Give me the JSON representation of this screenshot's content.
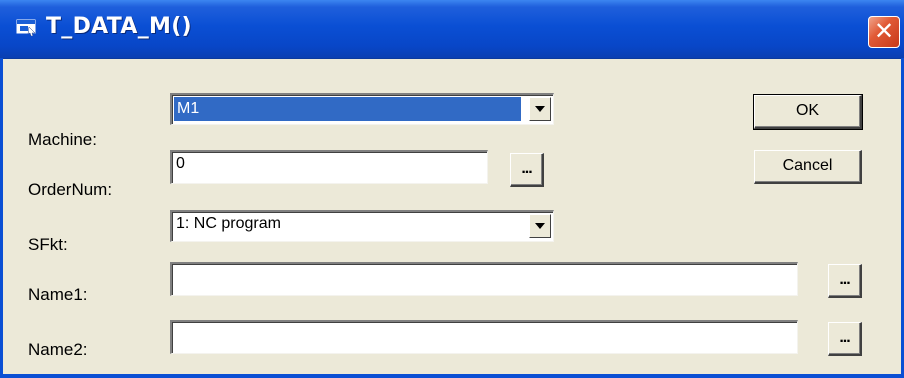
{
  "window": {
    "title": "T_DATA_M()",
    "close_label": "✕"
  },
  "fields": {
    "machine": {
      "label": "Machine:",
      "value": "M1"
    },
    "ordernum": {
      "label": "OrderNum:",
      "value": "0",
      "browse_label": "..."
    },
    "sfkt": {
      "label": "SFkt:",
      "value": "1: NC program"
    },
    "name1": {
      "label": "Name1:",
      "value": "",
      "browse_label": "..."
    },
    "name2": {
      "label": "Name2:",
      "value": "",
      "browse_label": "..."
    }
  },
  "buttons": {
    "ok": "OK",
    "cancel": "Cancel"
  },
  "colors": {
    "titlebar": "#0a4fd4",
    "dialog_bg": "#ece9d8",
    "selection": "#316ac5",
    "close": "#e15a36"
  },
  "icons": {
    "title_icon": "window-icon",
    "dropdown": "chevron-down-icon",
    "close": "close-icon"
  }
}
